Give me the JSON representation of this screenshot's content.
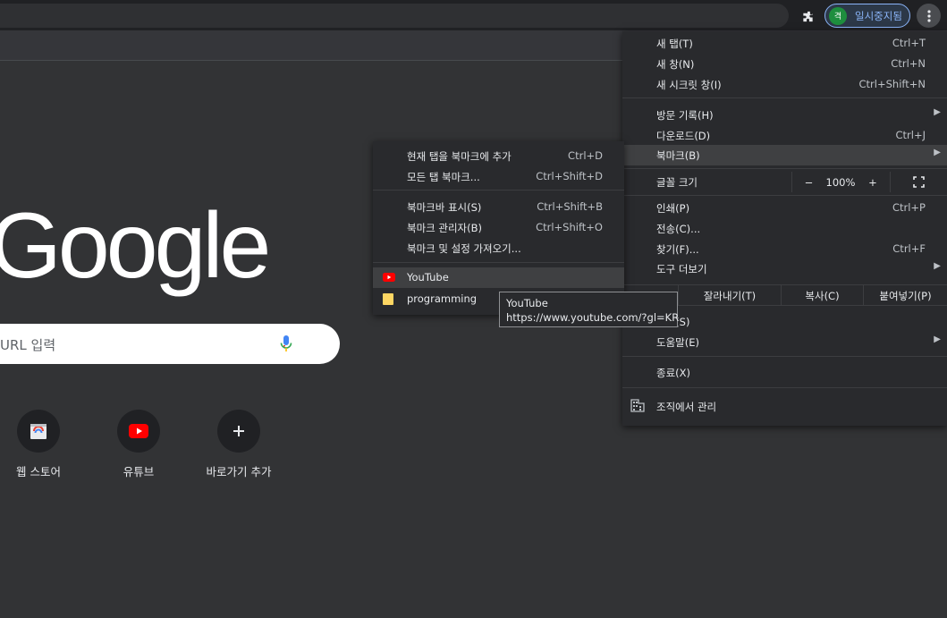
{
  "toolbar": {
    "profile_avatar": "격",
    "profile_label": "일시중지됨"
  },
  "page": {
    "logo": "Google",
    "search_placeholder": "URL 입력",
    "shortcuts": [
      {
        "label": "웹 스토어",
        "icon": "web-store-icon"
      },
      {
        "label": "유튜브",
        "icon": "youtube-icon"
      },
      {
        "label": "바로가기 추가",
        "icon": "plus-icon"
      }
    ]
  },
  "menu": {
    "new_tab": {
      "label": "새 탭(T)",
      "shortcut": "Ctrl+T"
    },
    "new_window": {
      "label": "새 창(N)",
      "shortcut": "Ctrl+N"
    },
    "new_incognito": {
      "label": "새 시크릿 창(I)",
      "shortcut": "Ctrl+Shift+N"
    },
    "history": {
      "label": "방문 기록(H)"
    },
    "downloads": {
      "label": "다운로드(D)",
      "shortcut": "Ctrl+J"
    },
    "bookmarks": {
      "label": "북마크(B)"
    },
    "zoom": {
      "label": "글꼴 크기",
      "minus": "−",
      "value": "100%",
      "plus": "+"
    },
    "print": {
      "label": "인쇄(P)",
      "shortcut": "Ctrl+P"
    },
    "cast": {
      "label": "전송(C)..."
    },
    "find": {
      "label": "찾기(F)...",
      "shortcut": "Ctrl+F"
    },
    "more_tools": {
      "label": "도구 더보기"
    },
    "edit": {
      "cut": "잘라내기(T)",
      "copy": "복사(C)",
      "paste": "붙여넣기(P)"
    },
    "settings": {
      "label": "설정(S)"
    },
    "help": {
      "label": "도움말(E)"
    },
    "exit": {
      "label": "종료(X)"
    },
    "managed": {
      "label": "조직에서 관리"
    }
  },
  "bookmark_submenu": {
    "add_current": {
      "label": "현재 탭을 북마크에 추가",
      "shortcut": "Ctrl+D"
    },
    "bookmark_all": {
      "label": "모든 탭 북마크...",
      "shortcut": "Ctrl+Shift+D"
    },
    "show_bar": {
      "label": "북마크바 표시(S)",
      "shortcut": "Ctrl+Shift+B"
    },
    "manager": {
      "label": "북마크 관리자(B)",
      "shortcut": "Ctrl+Shift+O"
    },
    "import": {
      "label": "북마크 및 설정 가져오기..."
    },
    "items": [
      {
        "label": "YouTube",
        "icon": "youtube-favicon"
      },
      {
        "label": "programming",
        "icon": "folder-icon"
      }
    ]
  },
  "tooltip": {
    "title": "YouTube",
    "url": "https://www.youtube.com/?gl=KR"
  },
  "colors": {
    "page_bg": "#323335",
    "menu_bg": "#292a2d",
    "highlight": "#3f4042",
    "accent": "#8ab4f8",
    "youtube_red": "#ff0000",
    "folder_yellow": "#fdd663"
  }
}
